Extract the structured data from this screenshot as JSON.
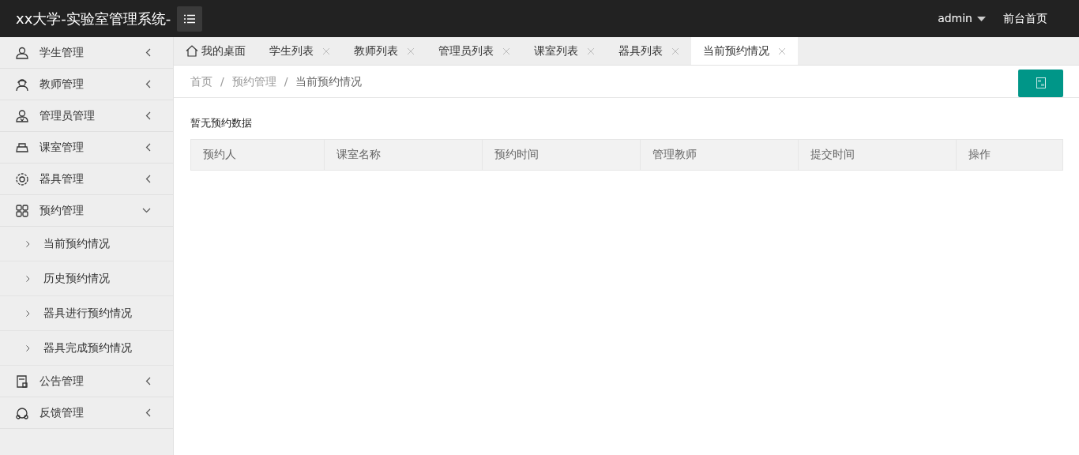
{
  "header": {
    "title": "xx大学-实验室管理系统-",
    "user": "admin",
    "home_link": "前台首页"
  },
  "sidebar": {
    "items": [
      {
        "label": "学生管理",
        "expanded": false
      },
      {
        "label": "教师管理",
        "expanded": false
      },
      {
        "label": "管理员管理",
        "expanded": false
      },
      {
        "label": "课室管理",
        "expanded": false
      },
      {
        "label": "器具管理",
        "expanded": false
      },
      {
        "label": "预约管理",
        "expanded": true,
        "children": [
          {
            "label": "当前预约情况"
          },
          {
            "label": "历史预约情况"
          },
          {
            "label": "器具进行预约情况"
          },
          {
            "label": "器具完成预约情况"
          }
        ]
      },
      {
        "label": "公告管理",
        "expanded": false
      },
      {
        "label": "反馈管理",
        "expanded": false
      }
    ]
  },
  "tabs": [
    {
      "label": "我的桌面",
      "kind": "home",
      "selected": false
    },
    {
      "label": "学生列表",
      "kind": "closable",
      "selected": false
    },
    {
      "label": "教师列表",
      "kind": "closable",
      "selected": false
    },
    {
      "label": "管理员列表",
      "kind": "closable",
      "selected": false
    },
    {
      "label": "课室列表",
      "kind": "closable",
      "selected": false
    },
    {
      "label": "器具列表",
      "kind": "closable",
      "selected": false
    },
    {
      "label": "当前预约情况",
      "kind": "closable",
      "selected": true
    }
  ],
  "breadcrumb": [
    {
      "kind": "link",
      "text": "首页"
    },
    {
      "kind": "separator",
      "text": "/"
    },
    {
      "kind": "link",
      "text": "预约管理"
    },
    {
      "kind": "separator",
      "text": "/"
    },
    {
      "kind": "current",
      "text": "当前预约情况"
    }
  ],
  "content": {
    "title": "暂无预约数据",
    "table": {
      "columns": [
        "预约人",
        "课室名称",
        "预约时间",
        "管理教师",
        "提交时间",
        "操作"
      ]
    }
  }
}
